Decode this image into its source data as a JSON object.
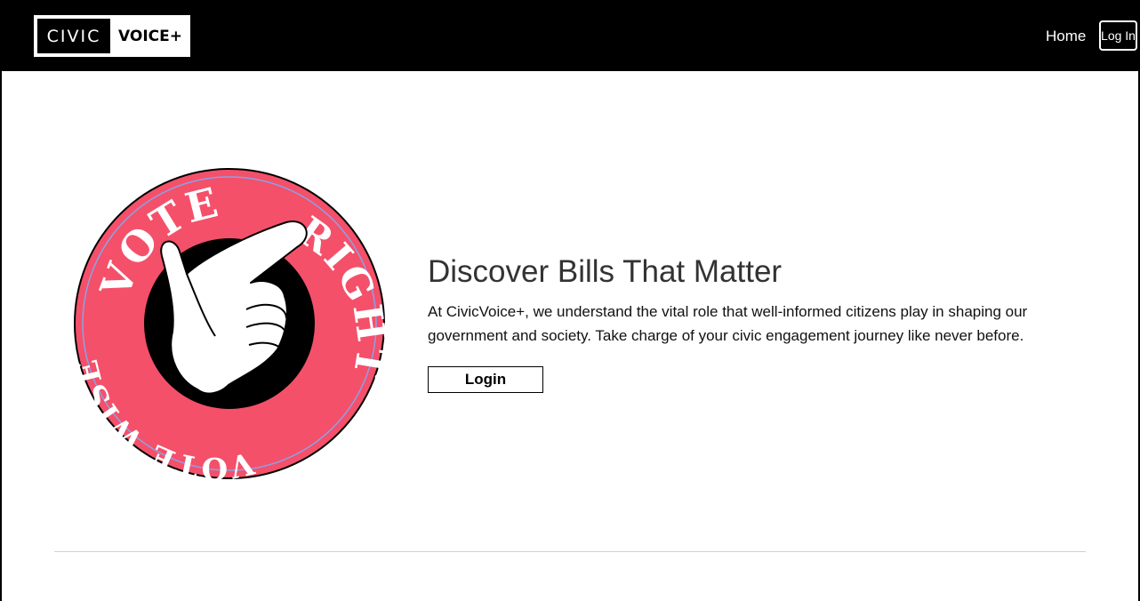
{
  "nav": {
    "logo_left": "CIVIC",
    "logo_right": "VOICE+",
    "home_label": "Home",
    "login_label": "Log In"
  },
  "hero": {
    "badge": {
      "top_text": "VOTE",
      "right_text": "RIGHT",
      "left_text": "VOTE WISE",
      "ring_color": "#f4506a",
      "center_color": "#000000"
    },
    "title": "Discover Bills That Matter",
    "description": "At CivicVoice+, we understand the vital role that well-informed citizens play in shaping our government and society. Take charge of your civic engagement journey like never before.",
    "login_label": "Login"
  }
}
